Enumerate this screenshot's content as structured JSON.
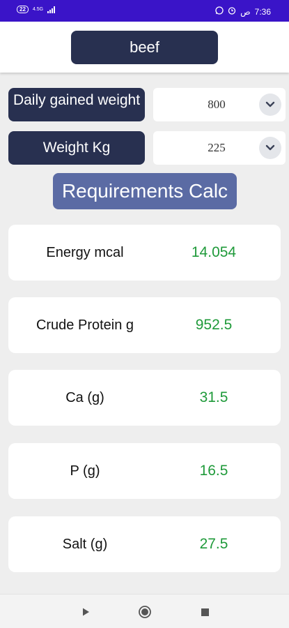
{
  "status_bar": {
    "battery": "22",
    "network": "4.5G",
    "time": "7:36",
    "ampm": "ص"
  },
  "header": {
    "title": "beef"
  },
  "inputs": [
    {
      "label": "Daily gained weight",
      "value": "800"
    },
    {
      "label": "Weight Kg",
      "value": "225"
    }
  ],
  "calc_button": "Requirements Calc",
  "results": [
    {
      "label": "Energy mcal",
      "value": "14.054"
    },
    {
      "label": "Crude Protein g",
      "value": "952.5"
    },
    {
      "label": "Ca (g)",
      "value": "31.5"
    },
    {
      "label": "P (g)",
      "value": "16.5"
    },
    {
      "label": "Salt (g)",
      "value": "27.5"
    }
  ],
  "colors": {
    "status_bar": "#3a14c8",
    "dark_button": "#283050",
    "calc_button": "#5b6ba4",
    "value_green": "#1f9a3a"
  },
  "icons": {
    "dropdown": "chevron-down-icon",
    "nav_back": "play-triangle-icon",
    "nav_home": "circle-home-icon",
    "nav_recents": "square-recents-icon"
  }
}
